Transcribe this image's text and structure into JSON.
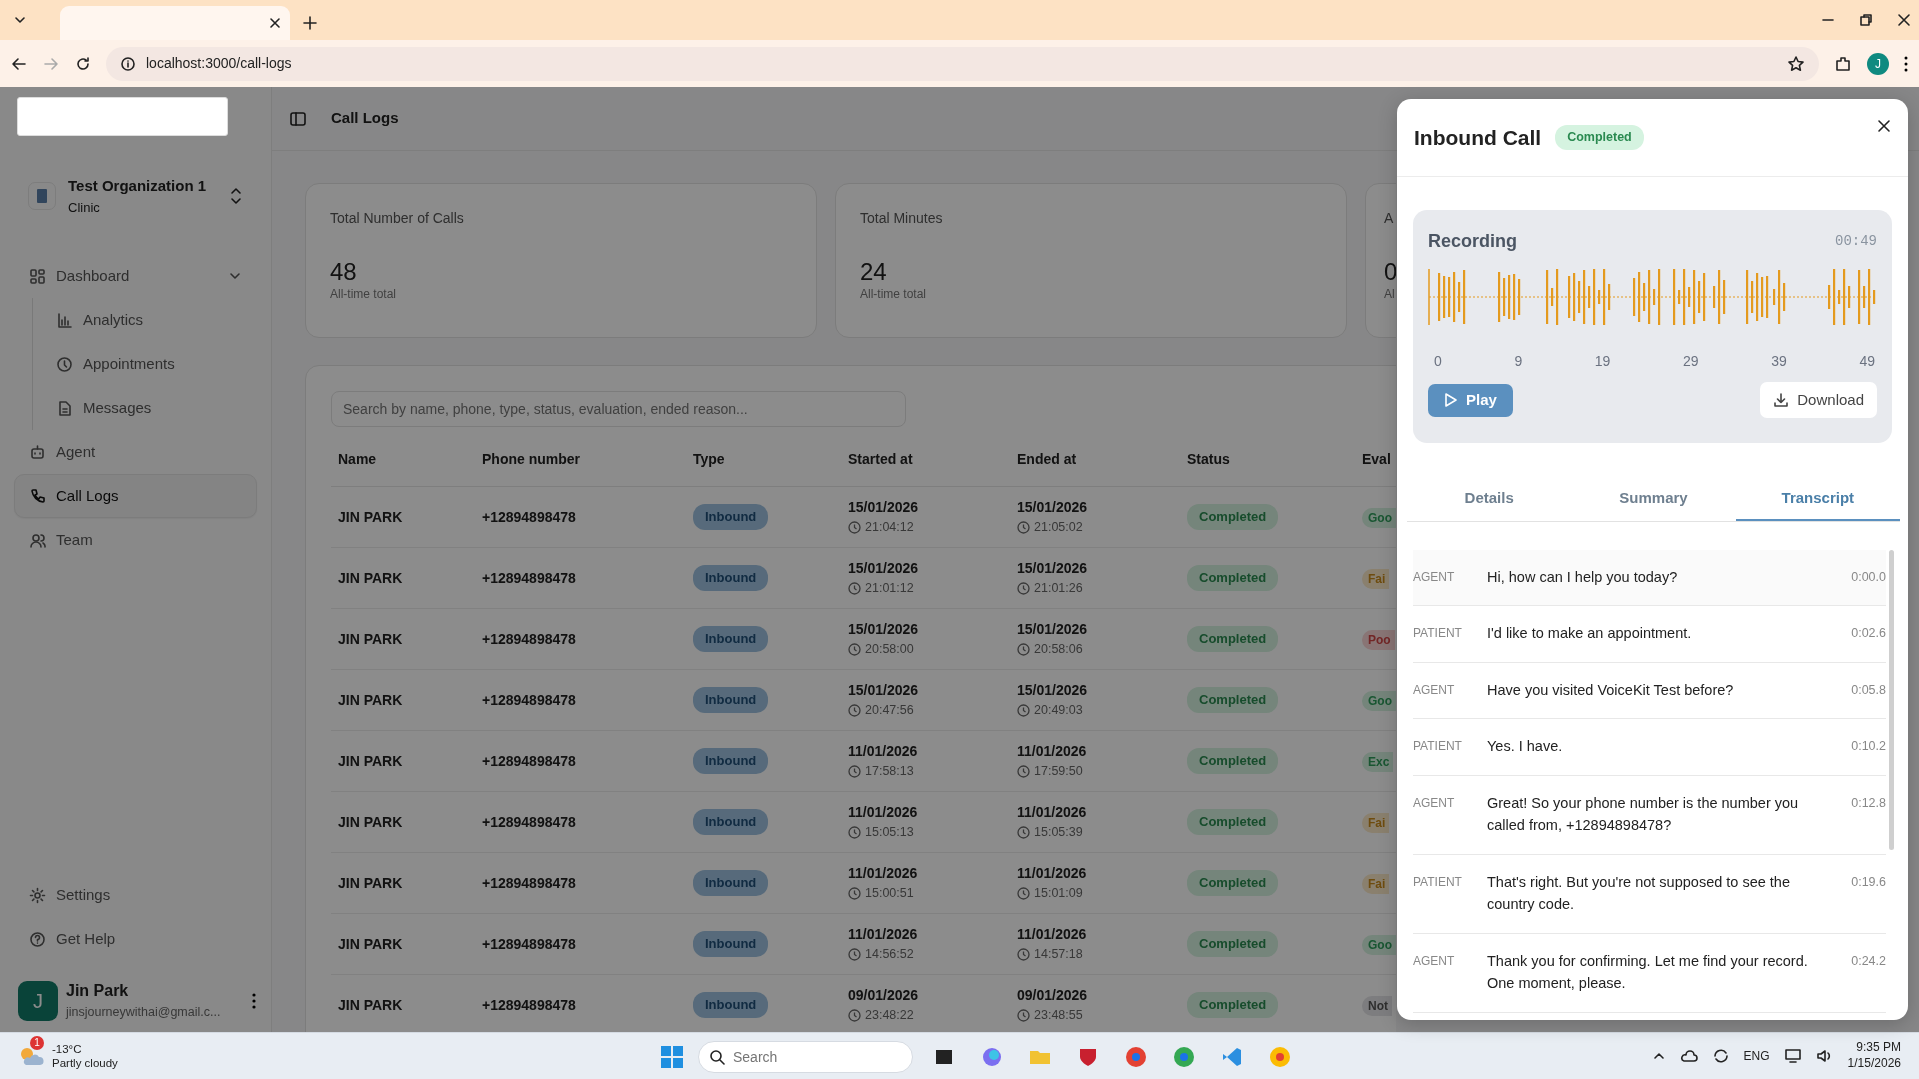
{
  "browser": {
    "url": "localhost:3000/call-logs",
    "profile_initial": "J"
  },
  "sidebar": {
    "org": {
      "name": "Test Organization 1",
      "type": "Clinic"
    },
    "nav": [
      {
        "label": "Dashboard",
        "selected": false,
        "expanded": true,
        "children": [
          {
            "label": "Analytics",
            "selected": false
          },
          {
            "label": "Appointments",
            "selected": false
          },
          {
            "label": "Messages",
            "selected": false
          }
        ]
      },
      {
        "label": "Agent",
        "selected": false
      },
      {
        "label": "Call Logs",
        "selected": true
      },
      {
        "label": "Team",
        "selected": false
      }
    ],
    "footer": [
      {
        "label": "Settings"
      },
      {
        "label": "Get Help"
      }
    ],
    "user": {
      "initial": "J",
      "name": "Jin Park",
      "email": "jinsjourneywithai@gmail.c..."
    }
  },
  "header": {
    "title": "Call Logs"
  },
  "stats": [
    {
      "title": "Total Number of Calls",
      "value": "48",
      "caption": "All-time total"
    },
    {
      "title": "Total Minutes",
      "value": "24",
      "caption": "All-time total"
    },
    {
      "title": "A",
      "value": "0",
      "caption": "Al"
    }
  ],
  "table": {
    "search": {
      "placeholder": "Search by name, phone, type, status, evaluation, ended reason..."
    },
    "columns": [
      "Name",
      "Phone number",
      "Type",
      "Started at",
      "Ended at",
      "Status",
      "Eval"
    ],
    "rows": [
      {
        "name": "JIN PARK",
        "phone": "+12894898478",
        "type": "Inbound",
        "start_date": "15/01/2026",
        "start_time": "21:04:12",
        "end_date": "15/01/2026",
        "end_time": "21:05:02",
        "status": "Completed",
        "evaluation": "Goo",
        "kind": "good"
      },
      {
        "name": "JIN PARK",
        "phone": "+12894898478",
        "type": "Inbound",
        "start_date": "15/01/2026",
        "start_time": "21:01:12",
        "end_date": "15/01/2026",
        "end_time": "21:01:26",
        "status": "Completed",
        "evaluation": "Fai",
        "kind": "fair"
      },
      {
        "name": "JIN PARK",
        "phone": "+12894898478",
        "type": "Inbound",
        "start_date": "15/01/2026",
        "start_time": "20:58:00",
        "end_date": "15/01/2026",
        "end_time": "20:58:06",
        "status": "Completed",
        "evaluation": "Poo",
        "kind": "poor"
      },
      {
        "name": "JIN PARK",
        "phone": "+12894898478",
        "type": "Inbound",
        "start_date": "15/01/2026",
        "start_time": "20:47:56",
        "end_date": "15/01/2026",
        "end_time": "20:49:03",
        "status": "Completed",
        "evaluation": "Goo",
        "kind": "good"
      },
      {
        "name": "JIN PARK",
        "phone": "+12894898478",
        "type": "Inbound",
        "start_date": "11/01/2026",
        "start_time": "17:58:13",
        "end_date": "11/01/2026",
        "end_time": "17:59:50",
        "status": "Completed",
        "evaluation": "Exc",
        "kind": "good"
      },
      {
        "name": "JIN PARK",
        "phone": "+12894898478",
        "type": "Inbound",
        "start_date": "11/01/2026",
        "start_time": "15:05:13",
        "end_date": "11/01/2026",
        "end_time": "15:05:39",
        "status": "Completed",
        "evaluation": "Fai",
        "kind": "fair"
      },
      {
        "name": "JIN PARK",
        "phone": "+12894898478",
        "type": "Inbound",
        "start_date": "11/01/2026",
        "start_time": "15:00:51",
        "end_date": "11/01/2026",
        "end_time": "15:01:09",
        "status": "Completed",
        "evaluation": "Fai",
        "kind": "fair"
      },
      {
        "name": "JIN PARK",
        "phone": "+12894898478",
        "type": "Inbound",
        "start_date": "11/01/2026",
        "start_time": "14:56:52",
        "end_date": "11/01/2026",
        "end_time": "14:57:18",
        "status": "Completed",
        "evaluation": "Goo",
        "kind": "good"
      },
      {
        "name": "JIN PARK",
        "phone": "+12894898478",
        "type": "Inbound",
        "start_date": "09/01/2026",
        "start_time": "23:48:22",
        "end_date": "09/01/2026",
        "end_time": "23:48:55",
        "status": "Completed",
        "evaluation": "Not",
        "kind": "none"
      }
    ]
  },
  "drawer": {
    "title": "Inbound Call",
    "status": "Completed",
    "recording": {
      "title": "Recording",
      "duration": "00:49",
      "ticks": [
        "0",
        "9",
        "19",
        "29",
        "39",
        "49"
      ],
      "play": "Play",
      "download": "Download"
    },
    "tabs": [
      {
        "label": "Details",
        "selected": false
      },
      {
        "label": "Summary",
        "selected": false
      },
      {
        "label": "Transcript",
        "selected": true
      }
    ],
    "transcript": [
      {
        "speaker": "AGENT",
        "text": "Hi, how can I help you today?",
        "time": "0:00.0"
      },
      {
        "speaker": "PATIENT",
        "text": "I'd like to make an appointment.",
        "time": "0:02.6"
      },
      {
        "speaker": "AGENT",
        "text": "Have you visited VoiceKit Test before?",
        "time": "0:05.8"
      },
      {
        "speaker": "PATIENT",
        "text": "Yes. I have.",
        "time": "0:10.2"
      },
      {
        "speaker": "AGENT",
        "text": "Great! So your phone number is the number you called from, +12894898478?",
        "time": "0:12.8"
      },
      {
        "speaker": "PATIENT",
        "text": "That's right. But you're not supposed to see the country code.",
        "time": "0:19.6"
      },
      {
        "speaker": "AGENT",
        "text": "Thank you for confirming. Let me find your record. One moment, please.",
        "time": "0:24.2"
      }
    ]
  },
  "taskbar": {
    "weather": {
      "badge": "1",
      "temperature": "-13°C",
      "description": "Partly cloudy"
    },
    "search": {
      "placeholder": "Search"
    },
    "language": "ENG",
    "time": "9:35 PM",
    "date": "1/15/2026"
  }
}
